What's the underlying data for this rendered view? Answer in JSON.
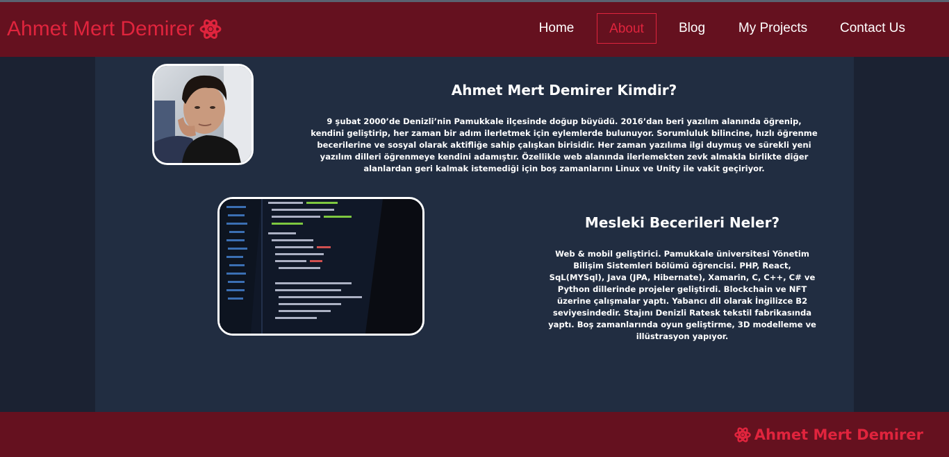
{
  "header": {
    "brand": "Ahmet Mert Demirer",
    "brand_icon": "atom-icon",
    "brand_color": "#e0243d",
    "background": "#65111f"
  },
  "nav": {
    "items": [
      {
        "label": "Home",
        "active": false
      },
      {
        "label": "About",
        "active": true
      },
      {
        "label": "Blog",
        "active": false
      },
      {
        "label": "My Projects",
        "active": false
      },
      {
        "label": "Contact Us",
        "active": false
      }
    ]
  },
  "about": {
    "title": "Ahmet Mert Demirer Kimdir?",
    "text": "9 şubat 2000’de Denizli’nin Pamukkale ilçesinde doğup büyüdü. 2016’dan beri yazılım alanında öğrenip, kendini geliştirip, her zaman bir adım ilerletmek için eylemlerde bulunuyor. Sorumluluk bilincine, hızlı öğrenme becerilerine ve sosyal olarak aktifliğe sahip çalışkan birisidir. Her zaman yazılıma ilgi duymuş ve sürekli yeni yazılım dilleri öğrenmeye kendini adamıştır. Özellikle web alanında ilerlemekten zevk almakla birlikte diğer alanlardan geri kalmak istemediği için boş zamanlarını Linux ve Unity ile vakit geçiriyor."
  },
  "skills": {
    "title": "Mesleki Becerileri Neler?",
    "text": "Web & mobil geliştirici. Pamukkale üniversitesi Yönetim Bilişim Sistemleri bölümü öğrencisi. PHP, React, SqL(MYSql), Java (JPA, Hibernate), Xamarin, C, C++, C# ve Python dillerinde projeler geliştirdi. Blockchain ve NFT üzerine çalışmalar yaptı. Yabancı dil olarak İngilizce B2 seviyesindedir. Stajını Denizli Ratesk tekstil fabrikasında yaptı. Boş zamanlarında oyun geliştirme, 3D modelleme ve illüstrasyon yapıyor."
  },
  "footer": {
    "brand": "Ahmet Mert Demirer",
    "brand_icon": "atom-icon"
  }
}
